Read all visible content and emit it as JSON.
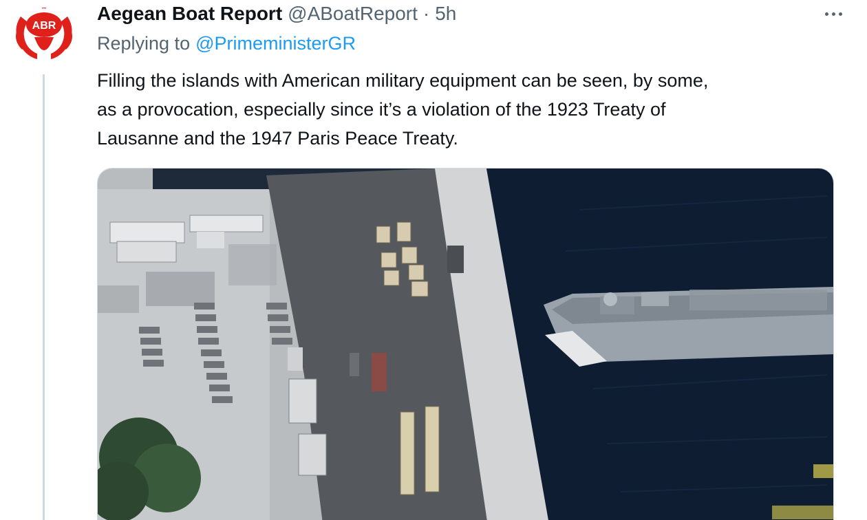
{
  "tweet": {
    "avatar_text": "ABR",
    "display_name": "Aegean Boat Report",
    "handle": "@ABoatReport",
    "separator": "·",
    "time": "5h",
    "replying_label": "Replying to",
    "replying_to": "@PrimeministerGR",
    "text_lines": [
      "Filling the islands with American military equipment can be seen, by some,",
      "as a provocation, especially since it’s a violation of the 1923 Treaty of",
      "Lausanne and the 1947 Paris Peace Treaty."
    ]
  },
  "icons": {
    "more": "more-horizontal-icon",
    "avatar_logo": "abr-logo-icon"
  },
  "colors": {
    "brand_red": "#e0201b",
    "link_blue": "#1d9bf0",
    "secondary_text": "#536471",
    "sea": "#0f1d33",
    "ship_hull": "#9aa3ab"
  }
}
